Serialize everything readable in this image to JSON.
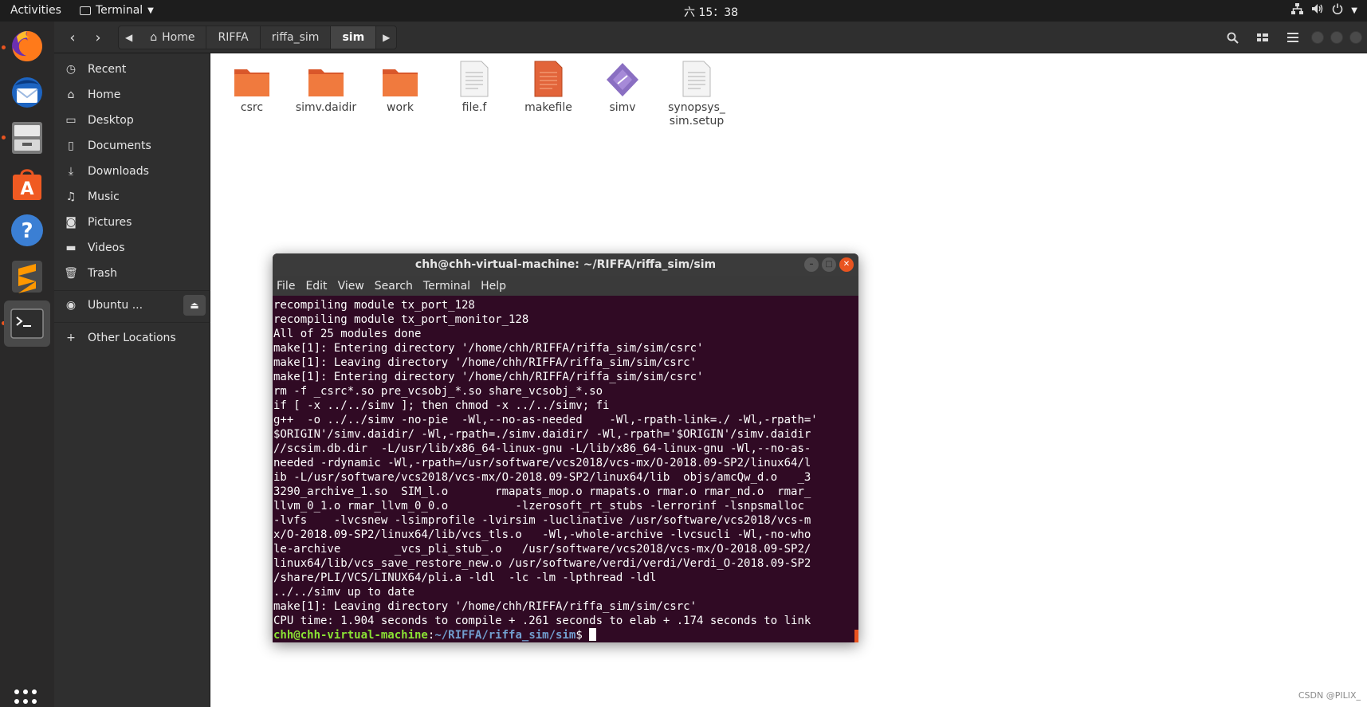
{
  "topbar": {
    "activities": "Activities",
    "app_name": "Terminal",
    "clock": "六 15：38"
  },
  "header": {
    "crumbs": [
      "Home",
      "RIFFA",
      "riffa_sim",
      "sim"
    ]
  },
  "sidebar": {
    "items": [
      "Recent",
      "Home",
      "Desktop",
      "Documents",
      "Downloads",
      "Music",
      "Pictures",
      "Videos",
      "Trash"
    ],
    "device": "Ubuntu ...",
    "other": "Other Locations"
  },
  "files": [
    {
      "name": "csrc",
      "type": "folder"
    },
    {
      "name": "simv.daidir",
      "type": "folder"
    },
    {
      "name": "work",
      "type": "folder"
    },
    {
      "name": "file.f",
      "type": "text"
    },
    {
      "name": "makefile",
      "type": "makefile",
      "selected": true
    },
    {
      "name": "simv",
      "type": "executable"
    },
    {
      "name": "synopsys_ sim.setup",
      "type": "text"
    }
  ],
  "terminal": {
    "title": "chh@chh-virtual-machine: ~/RIFFA/riffa_sim/sim",
    "menu": [
      "File",
      "Edit",
      "View",
      "Search",
      "Terminal",
      "Help"
    ],
    "lines": [
      "recompiling module tx_port_128",
      "recompiling module tx_port_monitor_128",
      "All of 25 modules done",
      "make[1]: Entering directory '/home/chh/RIFFA/riffa_sim/sim/csrc'",
      "make[1]: Leaving directory '/home/chh/RIFFA/riffa_sim/sim/csrc'",
      "make[1]: Entering directory '/home/chh/RIFFA/riffa_sim/sim/csrc'",
      "rm -f _csrc*.so pre_vcsobj_*.so share_vcsobj_*.so",
      "if [ -x ../../simv ]; then chmod -x ../../simv; fi",
      "g++  -o ../../simv -no-pie  -Wl,--no-as-needed    -Wl,-rpath-link=./ -Wl,-rpath='",
      "$ORIGIN'/simv.daidir/ -Wl,-rpath=./simv.daidir/ -Wl,-rpath='$ORIGIN'/simv.daidir",
      "//scsim.db.dir  -L/usr/lib/x86_64-linux-gnu -L/lib/x86_64-linux-gnu -Wl,--no-as-",
      "needed -rdynamic -Wl,-rpath=/usr/software/vcs2018/vcs-mx/O-2018.09-SP2/linux64/l",
      "ib -L/usr/software/vcs2018/vcs-mx/O-2018.09-SP2/linux64/lib  objs/amcQw_d.o   _3",
      "3290_archive_1.so  SIM_l.o       rmapats_mop.o rmapats.o rmar.o rmar_nd.o  rmar_",
      "llvm_0_1.o rmar_llvm_0_0.o          -lzerosoft_rt_stubs -lerrorinf -lsnpsmalloc ",
      "-lvfs    -lvcsnew -lsimprofile -lvirsim -luclinative /usr/software/vcs2018/vcs-m",
      "x/O-2018.09-SP2/linux64/lib/vcs_tls.o   -Wl,-whole-archive -lvcsucli -Wl,-no-who",
      "le-archive        _vcs_pli_stub_.o   /usr/software/vcs2018/vcs-mx/O-2018.09-SP2/",
      "linux64/lib/vcs_save_restore_new.o /usr/software/verdi/verdi/Verdi_O-2018.09-SP2",
      "/share/PLI/VCS/LINUX64/pli.a -ldl  -lc -lm -lpthread -ldl",
      "../../simv up to date",
      "make[1]: Leaving directory '/home/chh/RIFFA/riffa_sim/sim/csrc'",
      "CPU time: 1.904 seconds to compile + .261 seconds to elab + .174 seconds to link"
    ],
    "prompt_user": "chh@chh-virtual-machine",
    "prompt_path": "~/RIFFA/riffa_sim/sim",
    "prompt_suffix": "$ "
  },
  "watermark": "CSDN @PILIX_"
}
